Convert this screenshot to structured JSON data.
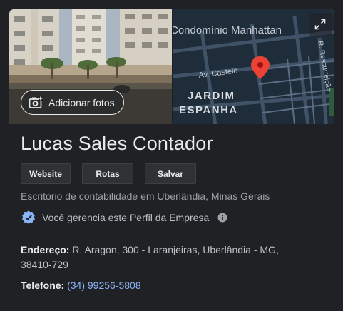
{
  "photos": {
    "add_photos_label": "Adicionar fotos",
    "map_labels": {
      "condominio": "Condomínio Manhattan",
      "avenue": "Av. Castelo",
      "neighborhood_line1": "JARDIM",
      "neighborhood_line2": "ESPANHA",
      "side_street": "R. Ressurreição"
    }
  },
  "business": {
    "name": "Lucas Sales Contador",
    "buttons": [
      "Website",
      "Rotas",
      "Salvar"
    ],
    "category": "Escritório de contabilidade em Uberlândia, Minas Gerais",
    "managed_text": "Você gerencia este Perfil da Empresa",
    "address_label": "Endereço:",
    "address_value": "R. Aragon, 300 - Laranjeiras, Uberlândia - MG, 38410-729",
    "phone_label": "Telefone:",
    "phone_value": "(34) 99256-5808"
  },
  "colors": {
    "background": "#202124",
    "text_primary": "#e8eaed",
    "text_secondary": "#9aa0a6",
    "link": "#8ab4f8",
    "verified_badge": "#8ab4f8",
    "map_pin": "#ea4335"
  },
  "icons": [
    "add-photo-icon",
    "expand-icon",
    "map-pin-icon",
    "verified-badge-icon",
    "info-icon"
  ]
}
